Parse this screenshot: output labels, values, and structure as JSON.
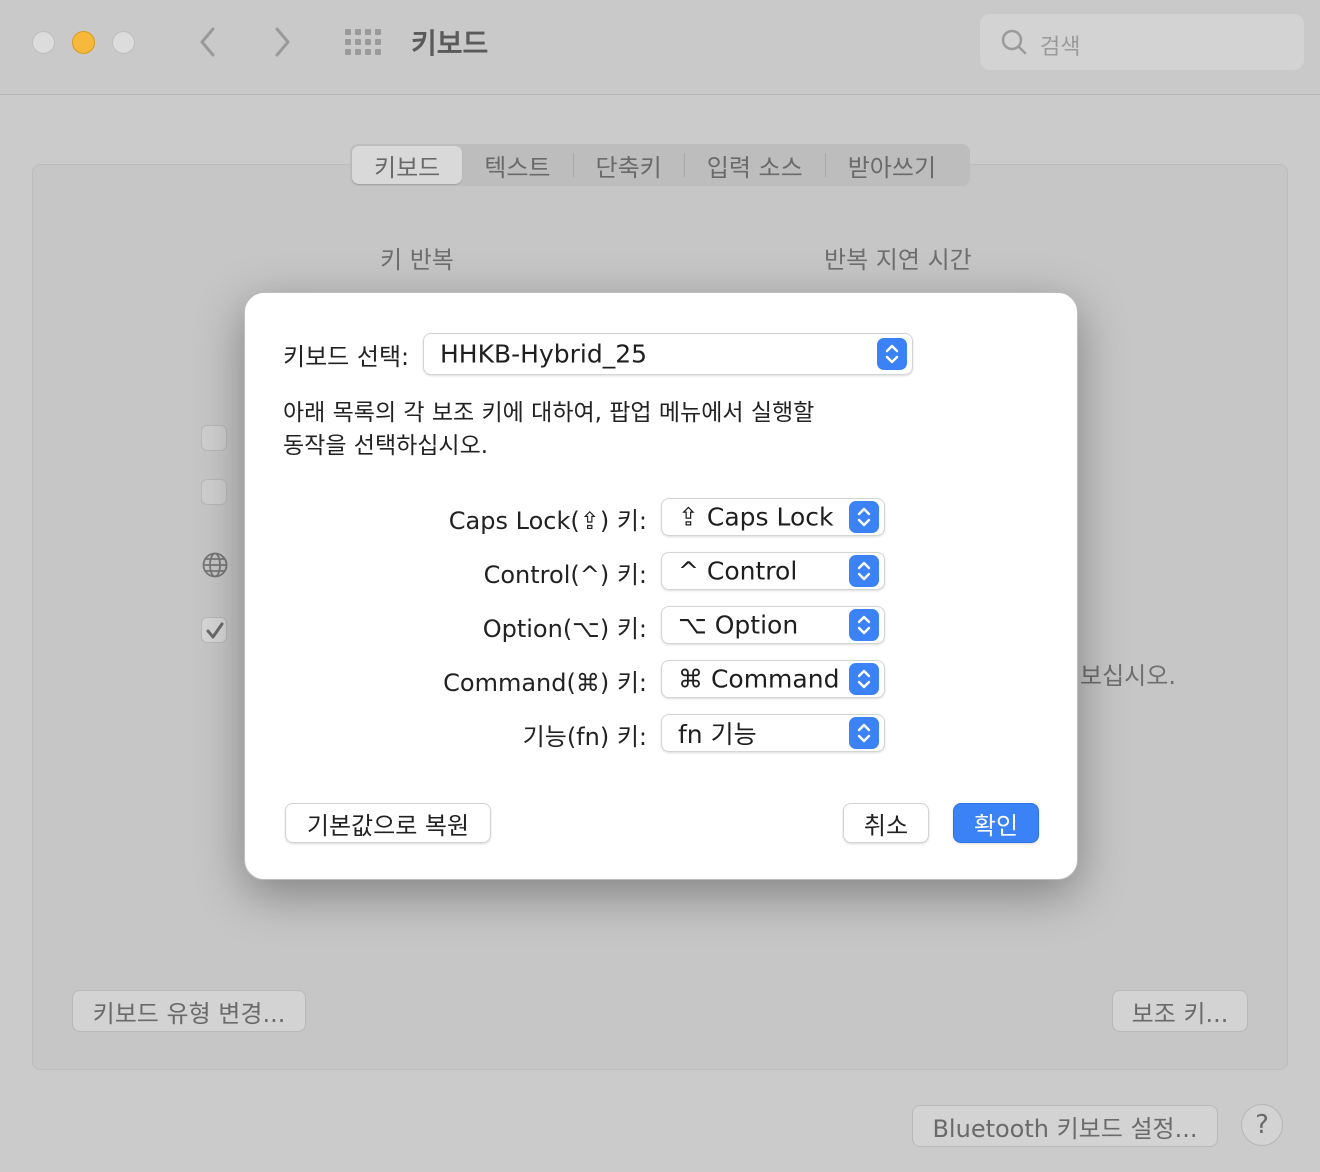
{
  "window": {
    "title": "키보드",
    "search_placeholder": "검색"
  },
  "tabs": [
    {
      "label": "키보드",
      "active": true
    },
    {
      "label": "텍스트"
    },
    {
      "label": "단축키"
    },
    {
      "label": "입력 소스"
    },
    {
      "label": "받아쓰기"
    }
  ],
  "background": {
    "key_repeat_label": "키 반복",
    "repeat_delay_label": "반복 지연 시간",
    "truncated_text": "보십시오.",
    "change_keyboard_type_button": "키보드 유형 변경...",
    "modifier_keys_button": "보조 키...",
    "bluetooth_button": "Bluetooth 키보드 설정...",
    "help_button": "?"
  },
  "dialog": {
    "keyboard_select_label": "키보드 선택:",
    "keyboard_select_value": "HHKB-Hybrid_25",
    "description_line1": "아래 목록의 각 보조 키에 대하여, 팝업 메뉴에서 실행할",
    "description_line2": "동작을 선택하십시오.",
    "rows": [
      {
        "label": "Caps Lock(⇪) 키:",
        "value": "⇪ Caps Lock"
      },
      {
        "label": "Control(^) 키:",
        "value": "^ Control"
      },
      {
        "label": "Option(⌥) 키:",
        "value": "⌥ Option"
      },
      {
        "label": "Command(⌘) 키:",
        "value": "⌘ Command"
      },
      {
        "label": "기능(fn) 키:",
        "value": "fn 기능"
      }
    ],
    "restore_defaults_button": "기본값으로 복원",
    "cancel_button": "취소",
    "ok_button": "확인"
  },
  "colors": {
    "accent": "#3b82f6",
    "minimize": "#f6b93b"
  }
}
